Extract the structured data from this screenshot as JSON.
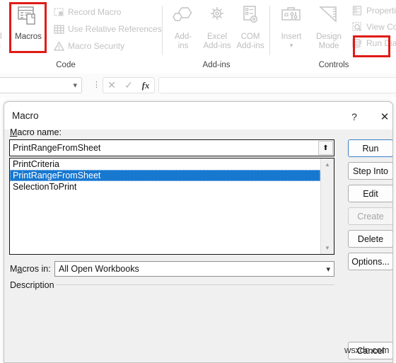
{
  "ribbon": {
    "groups": [
      {
        "name": "Code",
        "label": "Code",
        "big_buttons": [
          {
            "label": "Macros",
            "icon": "macros-icon",
            "enabled": true,
            "annotated": true
          }
        ],
        "small_buttons": [
          {
            "label": "Record Macro",
            "icon": "record-macro-icon"
          },
          {
            "label": "Use Relative References",
            "icon": "relative-references-icon"
          },
          {
            "label": "Macro Security",
            "icon": "macro-security-icon"
          }
        ]
      },
      {
        "name": "Add-ins",
        "label": "Add-ins",
        "big_buttons": [
          {
            "label": "Add-\nins",
            "icon": "addins-icon"
          },
          {
            "label": "Excel\nAdd-ins",
            "icon": "excel-addins-icon"
          },
          {
            "label": "COM\nAdd-ins",
            "icon": "com-addins-icon"
          }
        ],
        "small_buttons": []
      },
      {
        "name": "Controls",
        "label": "Controls",
        "big_buttons": [
          {
            "label": "Insert",
            "icon": "insert-controls-icon",
            "has_dropdown": true
          },
          {
            "label": "Design\nMode",
            "icon": "design-mode-icon"
          }
        ],
        "small_buttons": [
          {
            "label": "Properties",
            "icon": "properties-icon"
          },
          {
            "label": "View Code",
            "icon": "view-code-icon"
          },
          {
            "label": "Run Dialog",
            "icon": "run-dialog-icon"
          }
        ]
      }
    ]
  },
  "formula_bar": {
    "name_box_value": "",
    "name_box_placeholder": "",
    "cancel_icon": "cancel-x-icon",
    "enter_icon": "enter-check-icon",
    "function_icon": "insert-function-fx-icon",
    "formula_value": "",
    "formula_placeholder": ""
  },
  "dialog": {
    "title": "Macro",
    "help_icon": "help-question-icon",
    "close_icon": "close-x-icon",
    "macro_name_label": "Macro name:",
    "macro_name_value": "PrintRangeFromSheet",
    "macro_name_up_icon": "up-arrow-icon",
    "macro_list": [
      {
        "name": "PrintCriteria",
        "selected": false
      },
      {
        "name": "PrintRangeFromSheet",
        "selected": true
      },
      {
        "name": "SelectionToPrint",
        "selected": false
      }
    ],
    "scrollbar": {
      "up_icon": "scroll-up-arrow-icon",
      "down_icon": "scroll-down-arrow-icon"
    },
    "macros_in_label": "Macros in:",
    "macros_in_value": "All Open Workbooks",
    "macros_in_chevron_icon": "chevron-down-icon",
    "description_label": "Description",
    "buttons": [
      {
        "id": "run",
        "label": "Run",
        "enabled": true,
        "default": true,
        "annotated": true
      },
      {
        "id": "step",
        "label": "Step Into",
        "enabled": true,
        "default": false,
        "annotated": false
      },
      {
        "id": "edit",
        "label": "Edit",
        "enabled": true,
        "default": false,
        "annotated": false
      },
      {
        "id": "create",
        "label": "Create",
        "enabled": false,
        "default": false,
        "annotated": false
      },
      {
        "id": "delete",
        "label": "Delete",
        "enabled": true,
        "default": false,
        "annotated": false
      },
      {
        "id": "options",
        "label": "Options...",
        "enabled": true,
        "default": false,
        "annotated": false
      },
      {
        "id": "cancel",
        "label": "Cancel",
        "enabled": true,
        "default": false,
        "annotated": false
      }
    ]
  },
  "watermark": {
    "text": "wsxdn.com"
  },
  "colors": {
    "selection_blue": "#1878d0",
    "annotation_red": "#e01b16",
    "dialog_bg": "#f0f0f0",
    "default_button_border": "#3b7fc4"
  }
}
